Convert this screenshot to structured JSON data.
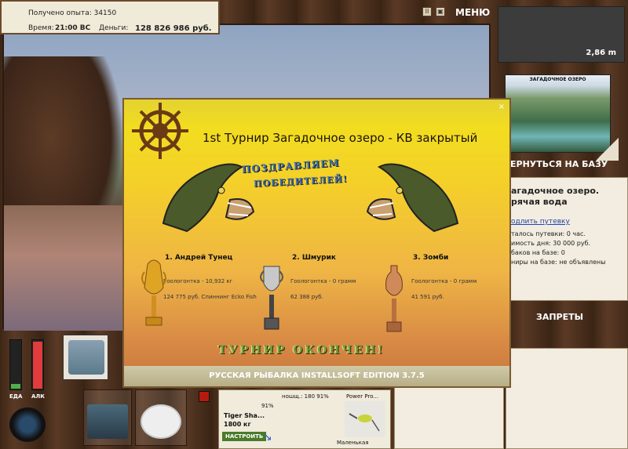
{
  "info": {
    "experience_label": "Получено опыта: 34150",
    "time_label": "Время:",
    "time_value": "21:00 ВС",
    "money_label": "Деньги:",
    "money_value": "128 826 986 руб."
  },
  "top_bar": {
    "pause": "II",
    "resize": "▣",
    "menu_label": "МЕНЮ"
  },
  "depth": {
    "value": "2,86 m"
  },
  "map": {
    "title": "ЗАГАДОЧНОЕ ОЗЕРО"
  },
  "nav": {
    "back_label": "ЕРНУТЬСЯ НА БАЗУ",
    "bans_label": "ЗАПРЕТЫ"
  },
  "lake": {
    "name": "агадочное озеро.",
    "water": "рячая вода",
    "link": "одлить путевку",
    "lines": [
      "талось путевки: 0 час.",
      "имость дня: 30 000 руб.",
      "баков на базе: 0",
      "ниры на базе: не объявлены"
    ]
  },
  "gauges": {
    "food_label": "ЕДА",
    "alc_label": "АЛК",
    "food_level": 0.1,
    "alc_level": 0.95
  },
  "equipment": {
    "line_name": "Tiger Sha...",
    "line_weight": "1800 кг",
    "line_percent": "91%",
    "setup_label": "НАСТРОИТЬ",
    "reel_info": "ношщ.: 180   91%",
    "reel_percent": "91%",
    "lure_name": "Power Pro...",
    "lure_size": "Маленькая"
  },
  "dialog": {
    "title": "1st Турнир Загадочное озеро - КВ закрытый",
    "congrats_line1": "ПОЗДРАВЛЯЕМ",
    "congrats_line2": "ПОБЕДИТЕЛЕЙ!",
    "places": [
      {
        "name": "1. Андрей Тунец",
        "catch": "Гоологонтка - 10,932 кг",
        "prize": "124 775 руб. Спиннинг Ecko Fish"
      },
      {
        "name": "2. Шмурик",
        "catch": "Гоологонтка - 0 грамм",
        "prize": "62 388 руб."
      },
      {
        "name": "3. Зомби",
        "catch": "Гоологонтка - 0 грамм",
        "prize": "41 591 руб."
      }
    ],
    "finished": "ТУРНИР ОКОНЧЕН!",
    "footer": "РУССКАЯ РЫБАЛКА INSTALLSOFT EDITION 3.7.5",
    "close": "×"
  }
}
